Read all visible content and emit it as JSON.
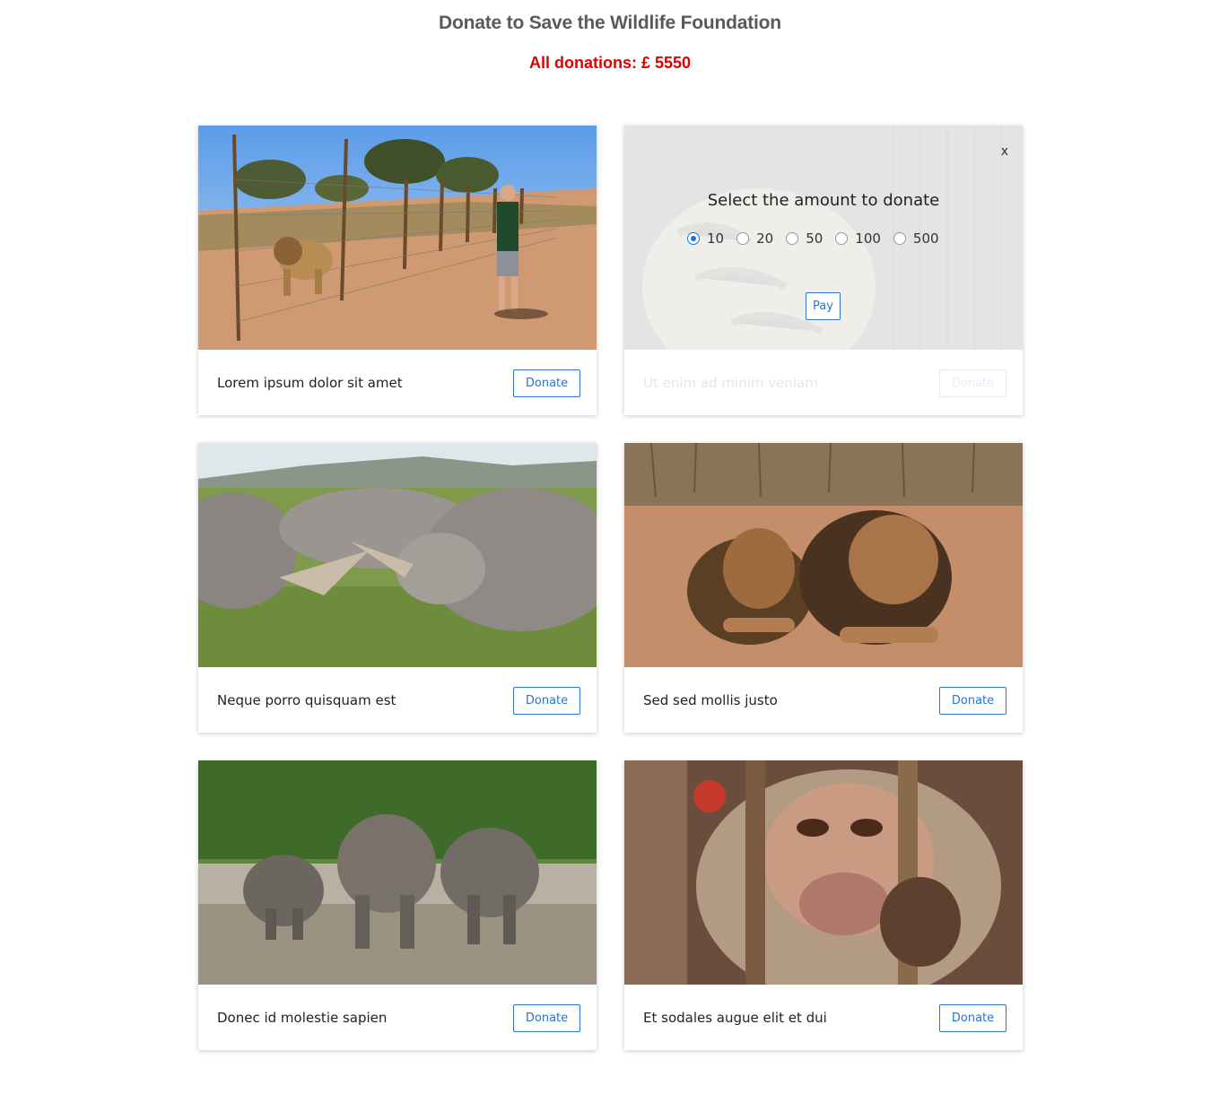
{
  "header": {
    "title": "Donate to Save the Wildlife Foundation",
    "total": "All donations: £ 5550"
  },
  "cards": [
    {
      "caption": "Lorem ipsum dolor sit amet",
      "button": "Donate",
      "photo": "man-walking-beside-lion-fence"
    },
    {
      "caption": "Ut enim ad minim veniam",
      "button": "Donate",
      "photo": "tiger-behind-cage"
    },
    {
      "caption": "Neque porro quisquam est",
      "button": "Donate",
      "photo": "rhinos-grazing"
    },
    {
      "caption": "Sed sed mollis justo",
      "button": "Donate",
      "photo": "two-lions-resting"
    },
    {
      "caption": "Donec id molestie sapien",
      "button": "Donate",
      "photo": "elephants-walking"
    },
    {
      "caption": "Et sodales augue elit et dui",
      "button": "Donate",
      "photo": "monkey-behind-bars"
    }
  ],
  "modal": {
    "close": "x",
    "title": "Select the amount to donate",
    "options": [
      "10",
      "20",
      "50",
      "100",
      "500"
    ],
    "selected": "10",
    "pay": "Pay"
  },
  "colors": {
    "accent": "#2c73c9",
    "total": "#e00000",
    "title": "#5a5a5a"
  }
}
